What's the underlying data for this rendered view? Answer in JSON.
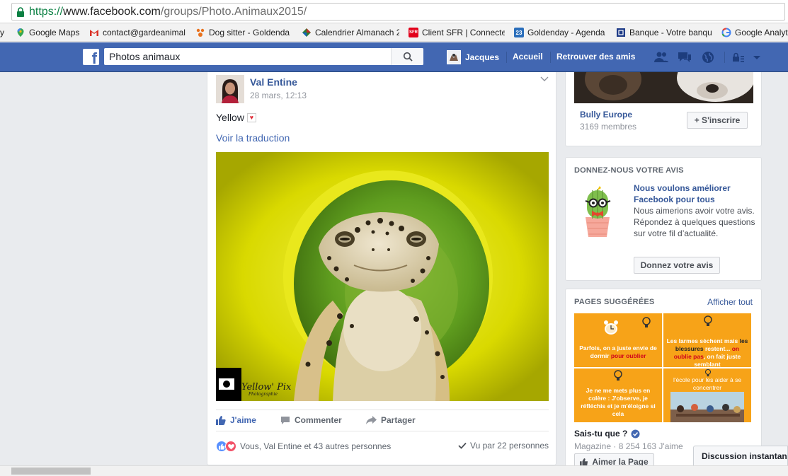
{
  "browser": {
    "url_scheme": "https://",
    "url_host": "www.facebook.com",
    "url_path": "/groups/Photo.Animaux2015/",
    "bookmarks": [
      {
        "label": "y",
        "icon": "none"
      },
      {
        "label": "Google Maps",
        "icon": "maps-pin-icon"
      },
      {
        "label": "contact@gardeanimal",
        "icon": "gmail-icon"
      },
      {
        "label": "Dog sitter - Goldenda",
        "icon": "goldenday-icon"
      },
      {
        "label": "Calendrier Almanach 2",
        "icon": "almanach-icon"
      },
      {
        "label": "Client SFR | Connecte",
        "icon": "sfr-icon"
      },
      {
        "label": "Goldenday - Agenda",
        "icon": "calendar-icon"
      },
      {
        "label": "Banque - Votre banqu",
        "icon": "bank-icon"
      },
      {
        "label": "Google Analyt",
        "icon": "google-icon"
      }
    ],
    "sfr_badge": "SFR",
    "calendar_day": "23"
  },
  "fb_header": {
    "logo": "f",
    "search_value": "Photos animaux",
    "user_name": "Jacques",
    "nav_home": "Accueil",
    "nav_friends": "Retrouver des amis",
    "colors": {
      "bar": "#4267b2",
      "link": "#365899"
    }
  },
  "post": {
    "author": "Val Entine",
    "timestamp": "28 mars, 12:13",
    "text": "Yellow",
    "heart": "♥",
    "translate_link": "Voir la traduction",
    "photo_alt": "Leopard gecko peeking through a yellow ring",
    "watermark_main": "Yellow' Pix",
    "watermark_sub": "Photographie",
    "actions": {
      "like": "J'aime",
      "comment": "Commenter",
      "share": "Partager"
    },
    "reactions_text": "Vous, Val Entine et 43 autres personnes",
    "seen_text": "Vu par 22 personnes"
  },
  "sidebar": {
    "group": {
      "name": "Bully Europe",
      "members": "3169 membres",
      "join_button": "+ S'inscrire"
    },
    "feedback": {
      "heading": "DONNEZ-NOUS VOTRE AVIS",
      "title": "Nous voulons améliorer Facebook pour tous",
      "body": "Nous aimerions avoir votre avis. Répondez à quelques questions sur votre fil d’actualité.",
      "button": "Donnez votre avis"
    },
    "suggested": {
      "heading": "PAGES SUGGÉRÉES",
      "show_all": "Afficher tout",
      "tile1": {
        "prefix": "Parfois, on a juste envie de dormir ",
        "highlight": "pour oublier"
      },
      "tile2": {
        "pre1": "Les larmes sèchent mais ",
        "mid1": "les blessures ",
        "post1": "restent... ",
        "mid2": "on oublie pas",
        "post2": ", on fait juste semblant"
      },
      "tile3": "Je ne me mets plus en colère : J'observe, je réfléchis et je m'éloigne si cela",
      "tile4": "l'école pour les aider à se concentrer",
      "page_name": "Sais-tu que ?",
      "page_meta": "Magazine · 8 254 163 J'aime",
      "like_button": "Aimer la Page"
    }
  },
  "chat": {
    "label": "Discussion instantanée"
  }
}
